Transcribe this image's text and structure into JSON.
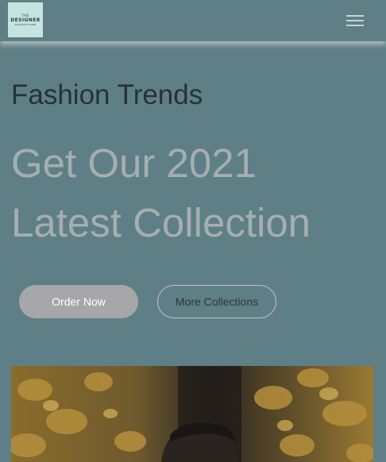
{
  "navbar": {
    "logo": {
      "line1": "THE",
      "line2": "DESIGNER",
      "line3": "FASHION STORE"
    },
    "menu_icon": "hamburger-menu-icon"
  },
  "hero": {
    "subtitle": "Fashion Trends",
    "headline_line1": "Get Our 2021",
    "headline_line2": "Latest Collection",
    "primary_button": "Order Now",
    "secondary_button": "More Collections"
  },
  "colors": {
    "background": "#5f7f86",
    "subtitle_text": "#243336",
    "headline_text": "#a5aeb0",
    "primary_button_bg": "#a6a7a9",
    "logo_bg": "#c5e3df"
  }
}
